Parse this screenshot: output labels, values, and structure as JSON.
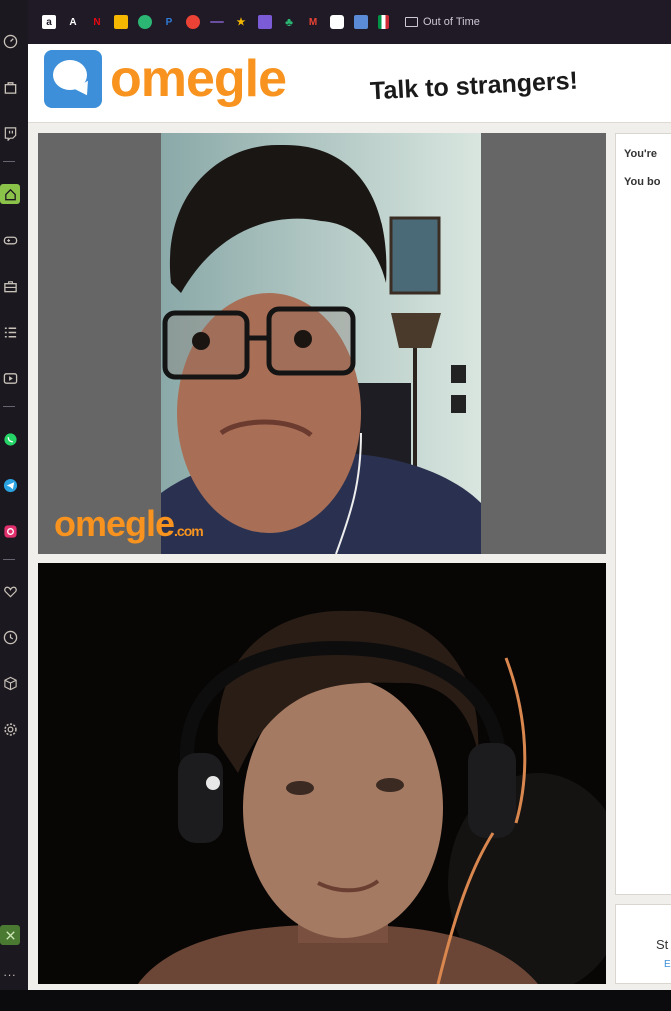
{
  "sidebar": {
    "items": [
      {
        "icon": "speedometer-icon"
      },
      {
        "icon": "bag-icon"
      },
      {
        "icon": "twitch-icon"
      },
      {
        "icon": "home-icon"
      },
      {
        "icon": "gamepad-icon"
      },
      {
        "icon": "briefcase-icon"
      },
      {
        "icon": "list-icon"
      },
      {
        "icon": "video-icon"
      },
      {
        "icon": "whatsapp-icon"
      },
      {
        "icon": "telegram-icon"
      },
      {
        "icon": "instagram-icon"
      },
      {
        "icon": "heart-icon"
      },
      {
        "icon": "clock-icon"
      },
      {
        "icon": "cube-icon"
      },
      {
        "icon": "settings-icon"
      }
    ],
    "more": "..."
  },
  "bookmarks": {
    "items": [
      {
        "icon": "amazon-icon",
        "glyph": "a",
        "color": "#ffffff"
      },
      {
        "icon": "font-icon",
        "glyph": "A",
        "color": "#1f1a26"
      },
      {
        "icon": "netflix-icon",
        "glyph": "N",
        "color": "#e50914"
      },
      {
        "icon": "notes-icon",
        "glyph": "",
        "color": "#f5b700"
      },
      {
        "icon": "green-circle-icon",
        "glyph": "",
        "color": "#2bb673"
      },
      {
        "icon": "paypal-icon",
        "glyph": "P",
        "color": "#1f1a26"
      },
      {
        "icon": "google-icon",
        "glyph": "",
        "color": "#ea4335"
      },
      {
        "icon": "link-icon",
        "glyph": "",
        "color": "#6a4ea0"
      },
      {
        "icon": "star-icon",
        "glyph": "★",
        "color": "#1f1a26"
      },
      {
        "icon": "chat-icon",
        "glyph": "",
        "color": "#7b5cd6"
      },
      {
        "icon": "tree-icon",
        "glyph": "",
        "color": "#2bb673"
      },
      {
        "icon": "gmail-icon",
        "glyph": "M",
        "color": "#1f1a26"
      },
      {
        "icon": "uber-icon",
        "glyph": "",
        "color": "#ffffff"
      },
      {
        "icon": "doc-icon",
        "glyph": "",
        "color": "#5b8bd6"
      },
      {
        "icon": "italy-flag-icon",
        "glyph": "",
        "color": "#009246"
      }
    ],
    "folder_label": "Out of Time"
  },
  "header": {
    "logo_text": "omegle",
    "tagline": "Talk to strangers!"
  },
  "stranger": {
    "watermark": "omegle",
    "watermark_suffix": ".com"
  },
  "chat": {
    "lines": [
      "You're",
      "You bo"
    ]
  },
  "controls": {
    "stop_label": "St",
    "esc_label": "E"
  },
  "colors": {
    "brand_orange": "#f7931e",
    "brand_blue": "#3c8fd8"
  }
}
